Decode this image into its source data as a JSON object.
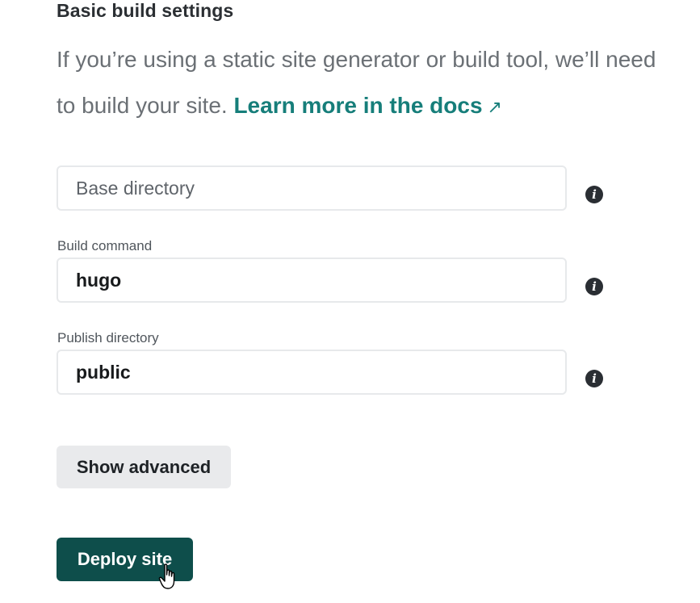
{
  "section": {
    "title": "Basic build settings",
    "description_line1": "If you’re using a static site generator or build tool, we’ll need",
    "description_line2": "to build your site.",
    "docs_link": "Learn more in the docs",
    "docs_link_icon": "external-arrow-icon"
  },
  "fields": {
    "base_directory": {
      "label": "",
      "placeholder": "Base directory",
      "value": ""
    },
    "build_command": {
      "label": "Build command",
      "value": "hugo"
    },
    "publish_directory": {
      "label": "Publish directory",
      "value": "public"
    }
  },
  "buttons": {
    "show_advanced": "Show advanced",
    "deploy": "Deploy site"
  },
  "icons": {
    "info": "info-icon",
    "cursor": "hand-pointer-icon"
  },
  "colors": {
    "link": "#167e7a",
    "primary": "#0e4e4b",
    "secondary_bg": "#e9eaec"
  }
}
